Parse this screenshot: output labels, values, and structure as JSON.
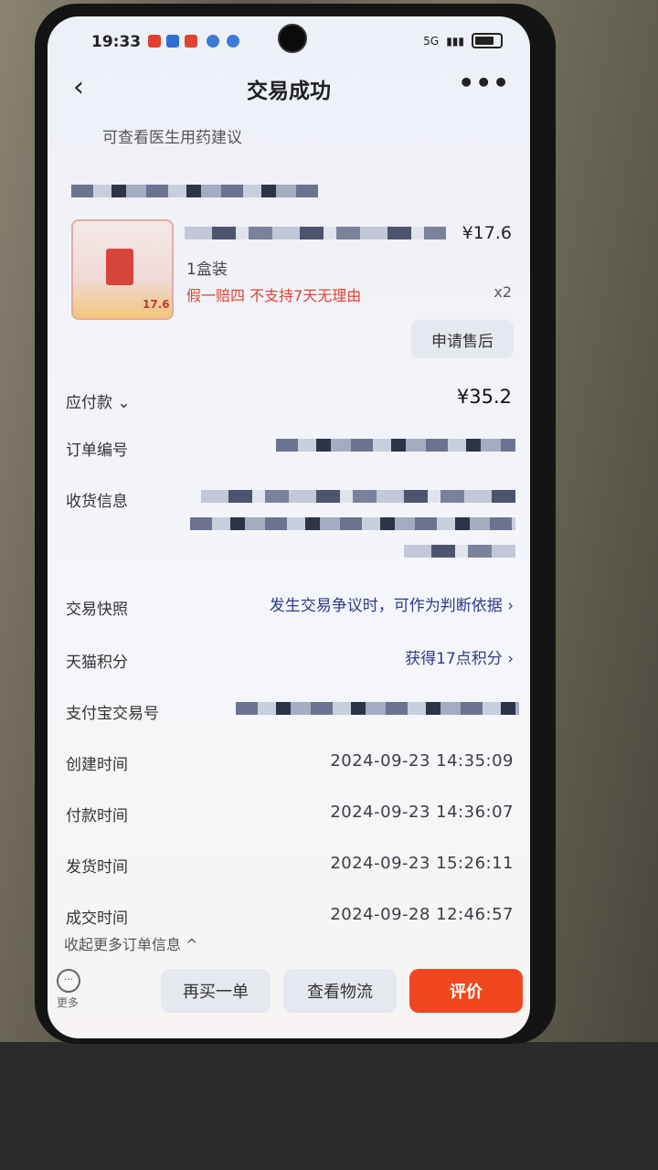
{
  "status_bar": {
    "time": "19:33",
    "network": "5G"
  },
  "header": {
    "title": "交易成功",
    "back_icon": "chevron-left-icon",
    "more_icon": "more-dots-icon",
    "more_label": "•••"
  },
  "advice": {
    "text": "可查看医生用药建议"
  },
  "product": {
    "price": "¥17.6",
    "spec": "1盒装",
    "badge": "假一赔四  不支持7天无理由",
    "quantity": "x2",
    "thumb_price": "17.6",
    "after_sale_button": "申请售后"
  },
  "payment": {
    "label": "应付款",
    "chevron": "⌄",
    "amount": "¥35.2"
  },
  "fields": {
    "order_no_label": "订单编号",
    "shipping_label": "收货信息",
    "snapshot_label": "交易快照",
    "snapshot_value": "发生交易争议时，可作为判断依据",
    "points_label": "天猫积分",
    "points_value": "获得17点积分",
    "alipay_label": "支付宝交易号",
    "chevron_right": "›"
  },
  "times": [
    {
      "label": "创建时间",
      "value": "2024-09-23 14:35:09"
    },
    {
      "label": "付款时间",
      "value": "2024-09-23 14:36:07"
    },
    {
      "label": "发货时间",
      "value": "2024-09-23 15:26:11"
    },
    {
      "label": "成交时间",
      "value": "2024-09-28 12:46:57"
    }
  ],
  "collapse_label": "收起更多订单信息 ^",
  "bottom_bar": {
    "more_label": "更多",
    "buy_again": "再买一单",
    "logistics": "查看物流",
    "review": "评价"
  },
  "colors": {
    "accent": "#f0471f",
    "badge_red": "#e0422f",
    "link": "#2f3a8a"
  }
}
